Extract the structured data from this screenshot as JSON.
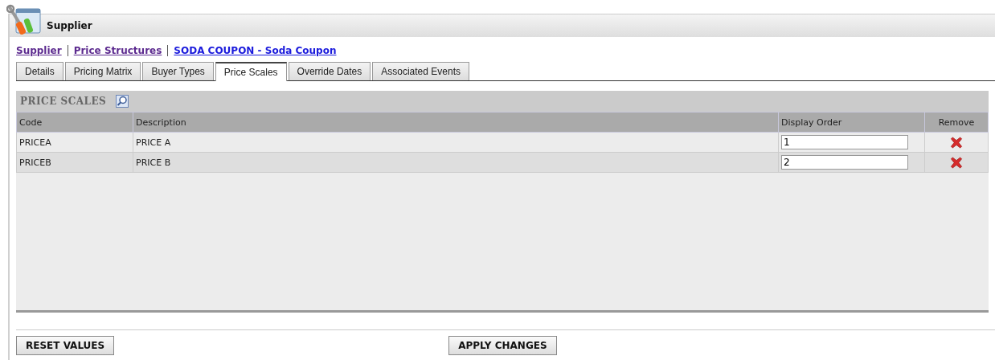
{
  "window": {
    "title": "Supplier"
  },
  "breadcrumb": [
    {
      "label": "Supplier",
      "visited": true
    },
    {
      "label": "Price Structures",
      "visited": true
    },
    {
      "label": "SODA COUPON - Soda Coupon",
      "visited": false
    }
  ],
  "tabs": [
    {
      "label": "Details",
      "selected": false
    },
    {
      "label": "Pricing Matrix",
      "selected": false
    },
    {
      "label": "Buyer Types",
      "selected": false
    },
    {
      "label": "Price Scales",
      "selected": true
    },
    {
      "label": "Override Dates",
      "selected": false
    },
    {
      "label": "Associated Events",
      "selected": false
    }
  ],
  "panel": {
    "title": "PRICE SCALES"
  },
  "table": {
    "columns": [
      "Code",
      "Description",
      "Display Order",
      "Remove"
    ],
    "rows": [
      {
        "code": "PRICEA",
        "description": "PRICE A",
        "order": "1"
      },
      {
        "code": "PRICEB",
        "description": "PRICE B",
        "order": "2"
      }
    ]
  },
  "buttons": [
    "RESET VALUES",
    "APPLY CHANGES"
  ]
}
